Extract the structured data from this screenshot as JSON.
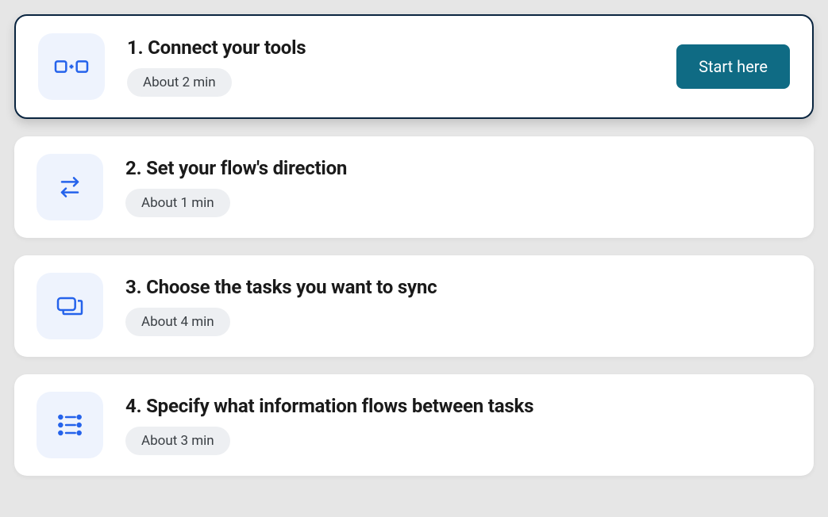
{
  "steps": [
    {
      "title": "1. Connect your tools",
      "duration": "About 2 min",
      "active": true,
      "button": "Start here"
    },
    {
      "title": "2. Set your flow's direction",
      "duration": "About 1 min",
      "active": false
    },
    {
      "title": "3. Choose the tasks you want to sync",
      "duration": "About 4 min",
      "active": false
    },
    {
      "title": "4. Specify what information flows between tasks",
      "duration": "About 3 min",
      "active": false
    }
  ]
}
